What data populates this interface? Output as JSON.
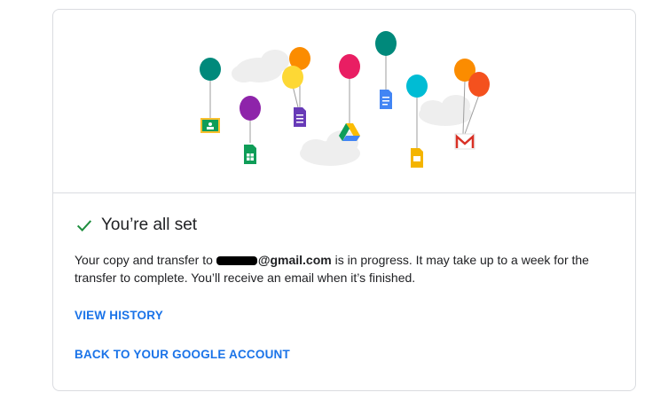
{
  "status": {
    "title": "You’re all set"
  },
  "message": {
    "prefix": "Your copy and transfer to ",
    "email_suffix": "@gmail.com",
    "suffix": " is in progress. It may take up to a week for the transfer to complete. You’ll receive an email when it’s finished."
  },
  "links": {
    "view_history": "VIEW HISTORY",
    "back_to_account": "BACK TO YOUR GOOGLE ACCOUNT"
  },
  "colors": {
    "accent": "#1a73e8",
    "success": "#1e8e3e",
    "text": "#202124",
    "border": "#dadce0"
  },
  "icons": [
    "check-icon",
    "google-classroom-icon",
    "google-sheets-icon",
    "google-forms-icon",
    "google-drive-icon",
    "google-docs-icon",
    "google-slides-icon",
    "gmail-icon"
  ]
}
